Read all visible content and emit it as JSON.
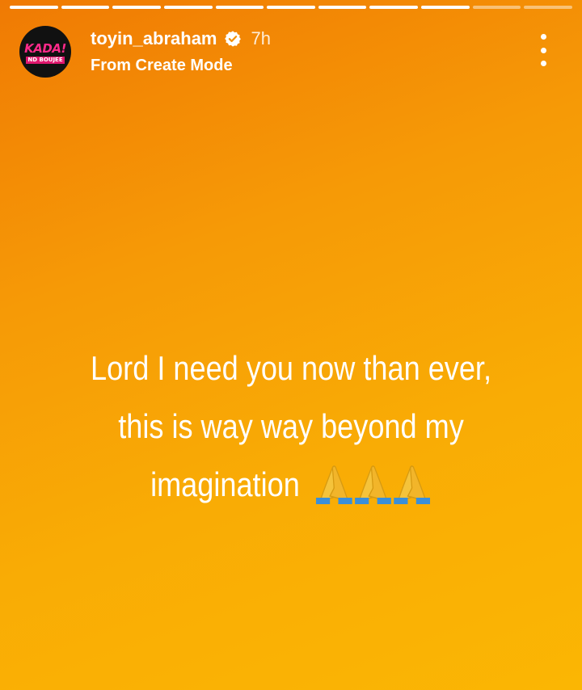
{
  "story": {
    "progress": {
      "total_segments": 11,
      "completed_segments": 9,
      "current_segment_fraction": 0.0
    },
    "header": {
      "avatar_text_top": "KADA!",
      "avatar_text_bottom": "ND BOUJEE",
      "username": "toyin_abraham",
      "verified_icon": "verified-badge-icon",
      "time": "7h",
      "subtitle": "From Create Mode",
      "more_icon": "more-vertical-icon"
    },
    "caption": {
      "line1": "Lord I need you now than ever,",
      "line2": "this is way way beyond my",
      "line3": "imagination",
      "emoji": "folded-hands-icon",
      "emoji_count": 3
    },
    "colors": {
      "gradient_start": "#f07a04",
      "gradient_end": "#fbb603",
      "text": "#ffffff"
    }
  }
}
